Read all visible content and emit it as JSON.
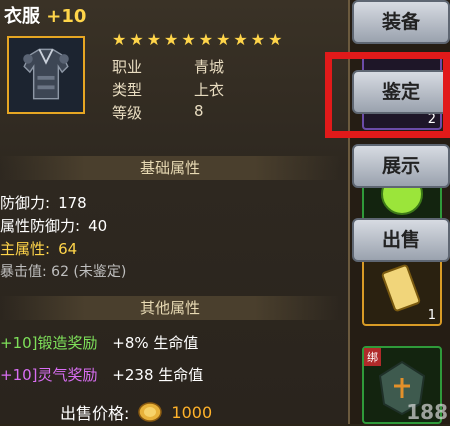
{
  "item": {
    "name": "衣服",
    "enhance": "+10",
    "stars": 10,
    "star_glyph": "★",
    "fields": [
      {
        "label": "职业",
        "value": "青城"
      },
      {
        "label": "类型",
        "value": "上衣"
      },
      {
        "label": "等级",
        "value": "8"
      }
    ]
  },
  "basic": {
    "title": "基础属性",
    "defense_label": "防御力:",
    "defense_value": "178",
    "attr_def_label": "属性防御力:",
    "attr_def_value": "40",
    "main_label": "主属性:",
    "main_value": "64",
    "crit_text": "暴击值: 62 (未鉴定)"
  },
  "other": {
    "title": "其他属性",
    "forge_label": "+10]锻造奖励",
    "forge_value": "+8% 生命值",
    "aura_label": "+10]灵气奖励",
    "aura_value": "+238 生命值"
  },
  "sell": {
    "label": "出售价格:",
    "price": "1000"
  },
  "buttons": {
    "equip": "装备",
    "identify": "鉴定",
    "show": "展示",
    "sell": "出售"
  },
  "slots": {
    "slot1_count": "2",
    "slot3_count": "1",
    "bind_label": "绑"
  },
  "watermark": "188",
  "colors": {
    "highlight": "#e11a1a",
    "gold": "#ffd54a",
    "green_bonus": "#7ee05a",
    "purple_bonus": "#d86ef2"
  }
}
